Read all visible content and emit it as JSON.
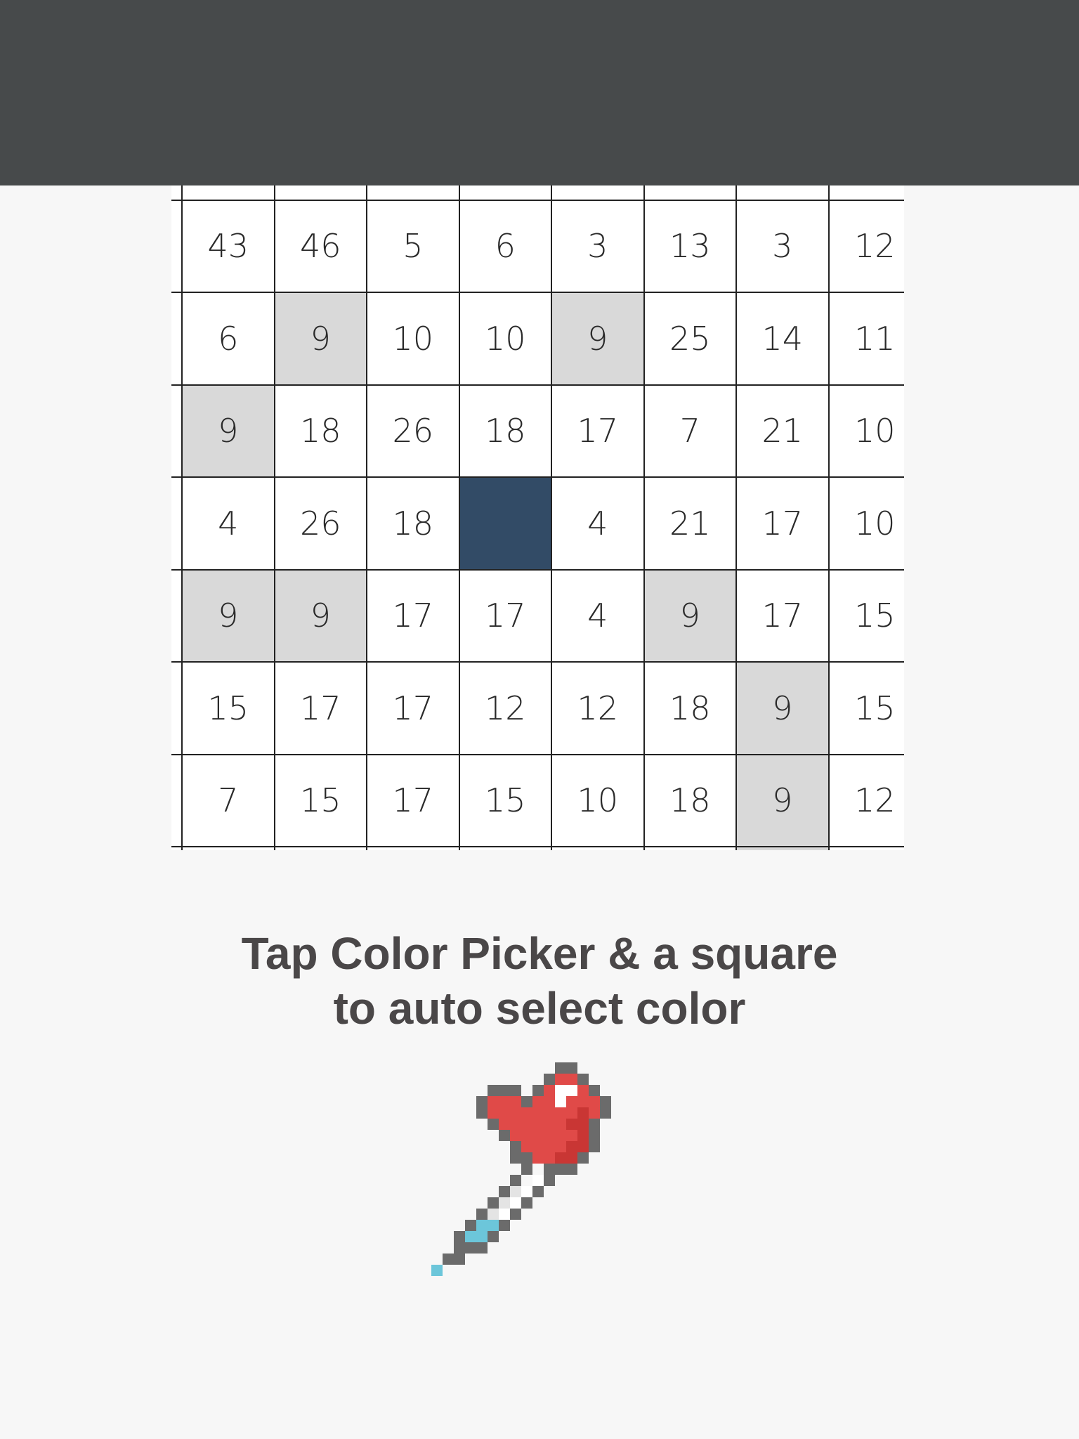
{
  "colors": {
    "top_bar": "#474a4b",
    "background": "#f7f7f7",
    "cell_white": "#ffffff",
    "cell_highlight": "#d9d9d9",
    "cell_filled": "#324b66",
    "grid_line": "#222222",
    "text": "#4a4748"
  },
  "grid": {
    "columns": 8,
    "rows": [
      [
        "",
        "",
        "",
        "",
        "",
        "",
        "",
        ""
      ],
      [
        "43",
        "46",
        "5",
        "6",
        "3",
        "13",
        "3",
        "12"
      ],
      [
        "6",
        "9",
        "10",
        "10",
        "9",
        "25",
        "14",
        "11"
      ],
      [
        "9",
        "18",
        "26",
        "18",
        "17",
        "7",
        "21",
        "10"
      ],
      [
        "4",
        "26",
        "18",
        "",
        "4",
        "21",
        "17",
        "10"
      ],
      [
        "9",
        "9",
        "17",
        "17",
        "4",
        "9",
        "17",
        "15"
      ],
      [
        "15",
        "17",
        "17",
        "12",
        "12",
        "18",
        "9",
        "15"
      ],
      [
        "7",
        "15",
        "17",
        "15",
        "10",
        "18",
        "9",
        "12"
      ],
      [
        "",
        "",
        "",
        "",
        "",
        "",
        "",
        ""
      ]
    ],
    "highlighted_cells": [
      [
        2,
        1
      ],
      [
        2,
        4
      ],
      [
        3,
        0
      ],
      [
        5,
        0
      ],
      [
        5,
        1
      ],
      [
        5,
        5
      ],
      [
        6,
        6
      ],
      [
        7,
        6
      ],
      [
        8,
        6
      ]
    ],
    "filled_cells": [
      [
        4,
        3
      ]
    ]
  },
  "instruction": {
    "line1": "Tap Color Picker & a square",
    "line2": "to auto select color"
  },
  "icon": "color-picker-dropper-icon"
}
